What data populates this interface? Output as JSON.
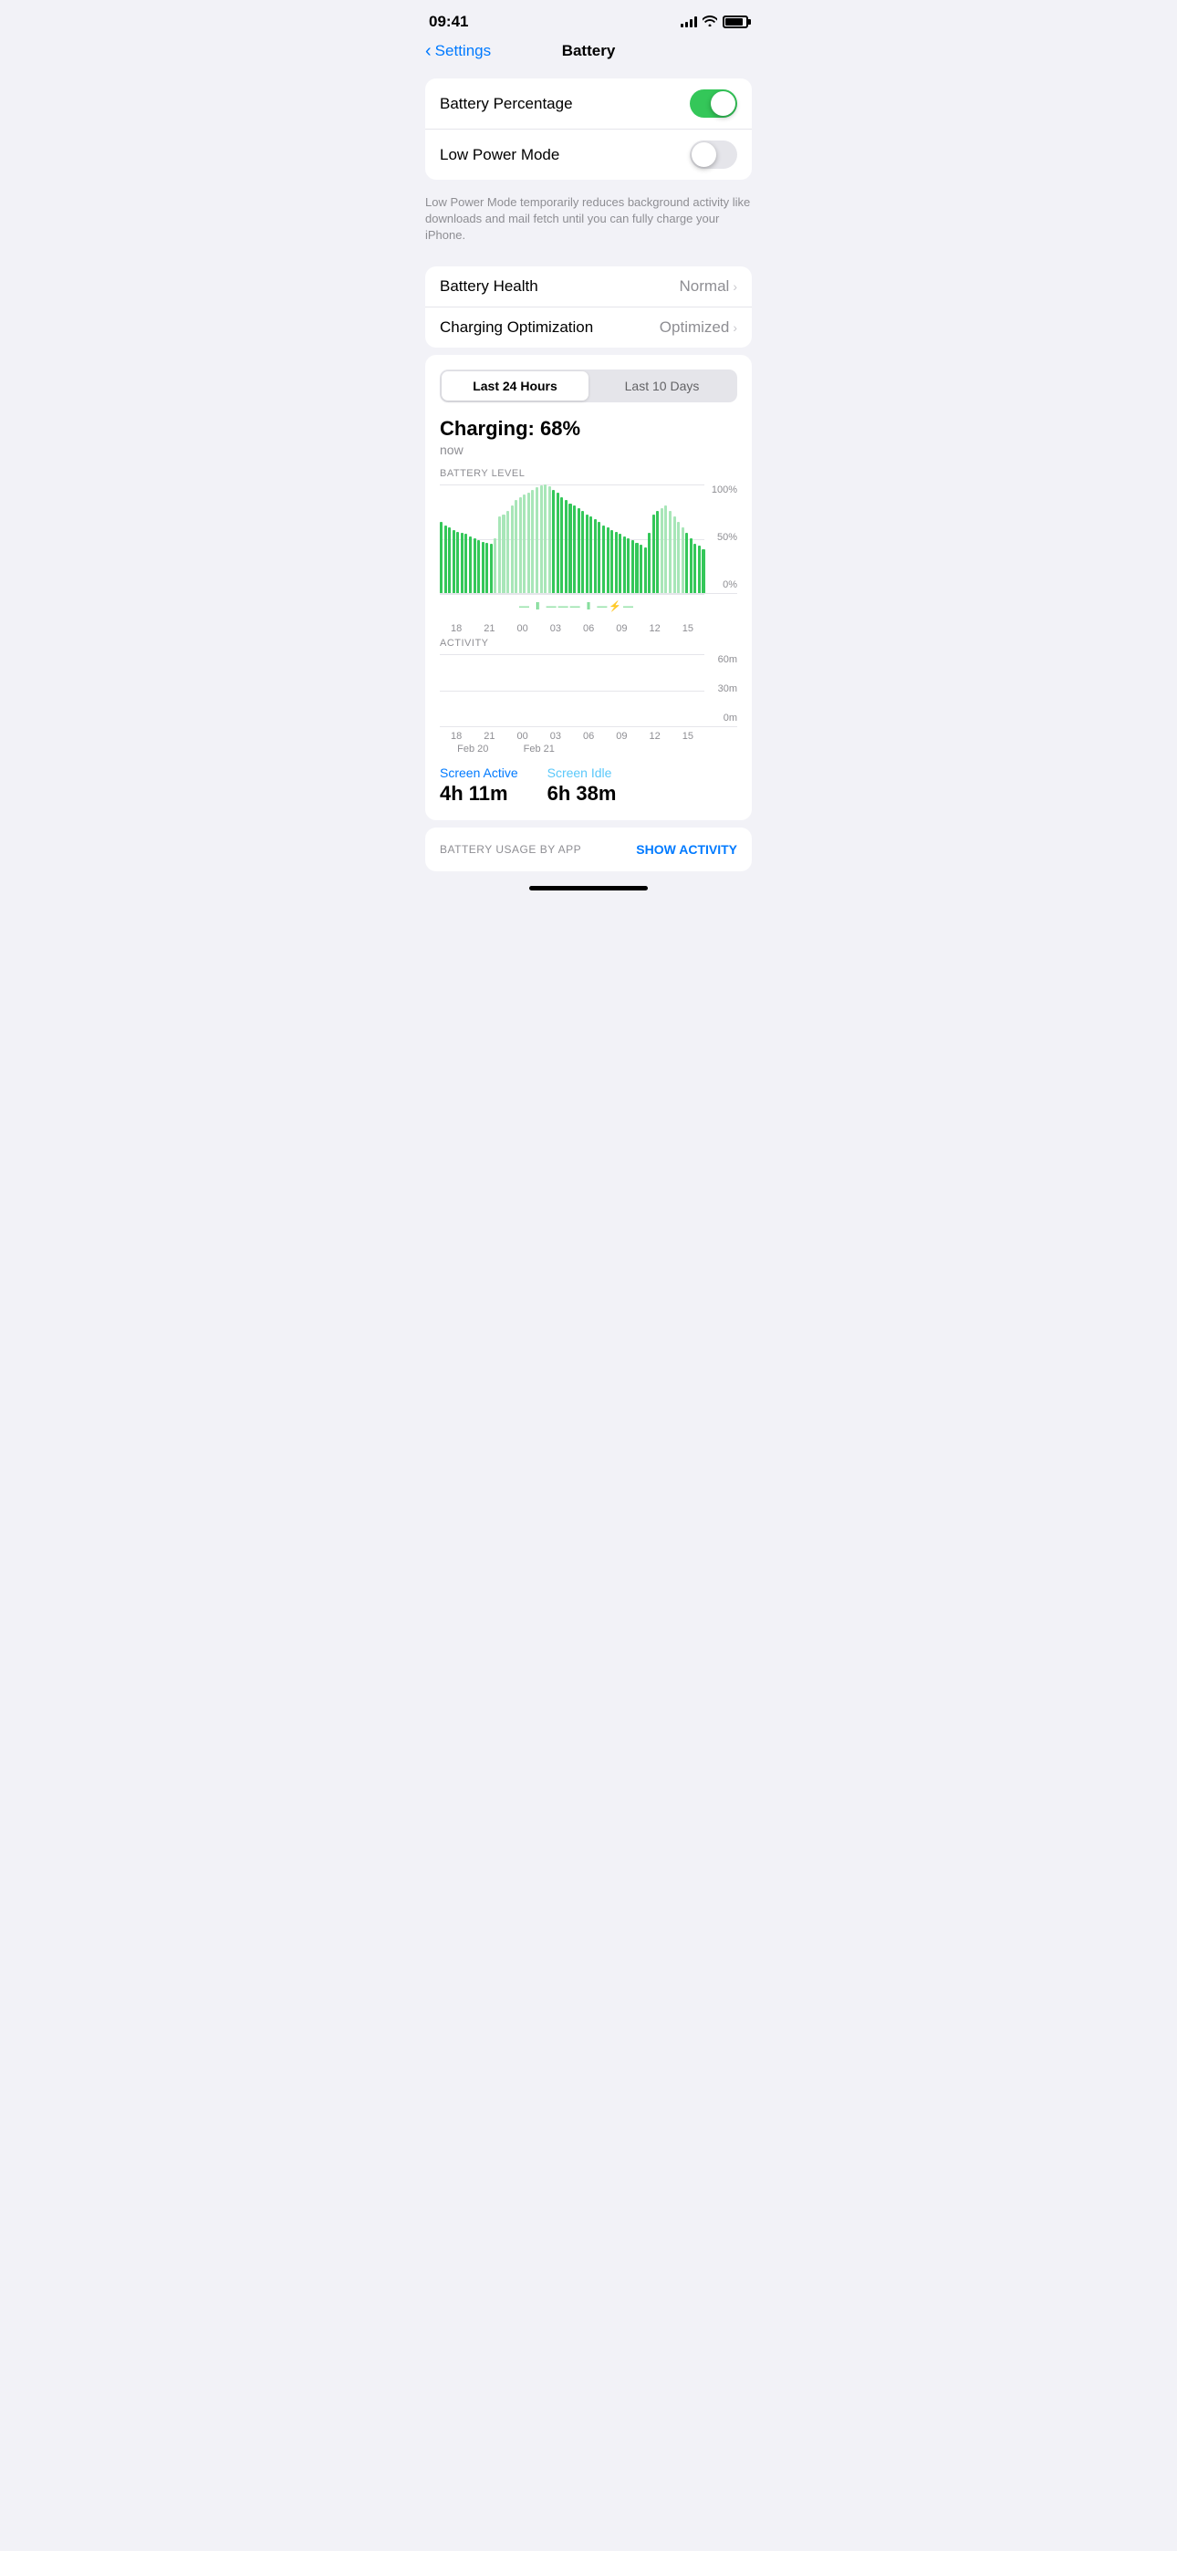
{
  "statusBar": {
    "time": "09:41",
    "battery": "85"
  },
  "nav": {
    "back": "Settings",
    "title": "Battery"
  },
  "toggleSection": {
    "batteryPercentage": {
      "label": "Battery Percentage",
      "enabled": true
    },
    "lowPowerMode": {
      "label": "Low Power Mode",
      "enabled": false
    },
    "description": "Low Power Mode temporarily reduces background activity like downloads and mail fetch until you can fully charge your iPhone."
  },
  "healthSection": {
    "batteryHealth": {
      "label": "Battery Health",
      "value": "Normal"
    },
    "chargingOptimization": {
      "label": "Charging Optimization",
      "value": "Optimized"
    }
  },
  "usageSection": {
    "segment": {
      "option1": "Last 24 Hours",
      "option2": "Last 10 Days",
      "active": 0
    },
    "charging": {
      "label": "Charging: 68%",
      "time": "now"
    },
    "batteryChartLabel": "BATTERY LEVEL",
    "batteryYLabels": [
      "100%",
      "50%",
      "0%"
    ],
    "batteryXLabels": [
      "18",
      "21",
      "00",
      "03",
      "06",
      "09",
      "12",
      "15"
    ],
    "activityChartLabel": "ACTIVITY",
    "activityYLabels": [
      "60m",
      "30m",
      "0m"
    ],
    "activityXLabels": [
      "18",
      "21",
      "00",
      "03",
      "06",
      "09",
      "12",
      "15"
    ],
    "dateLabels": [
      "Feb 20",
      "Feb 21"
    ],
    "screenActive": {
      "label": "Screen Active",
      "value": "4h 11m"
    },
    "screenIdle": {
      "label": "Screen Idle",
      "value": "6h 38m"
    }
  },
  "bottomSection": {
    "label": "BATTERY USAGE BY APP",
    "showActivity": "SHOW ACTIVITY"
  }
}
